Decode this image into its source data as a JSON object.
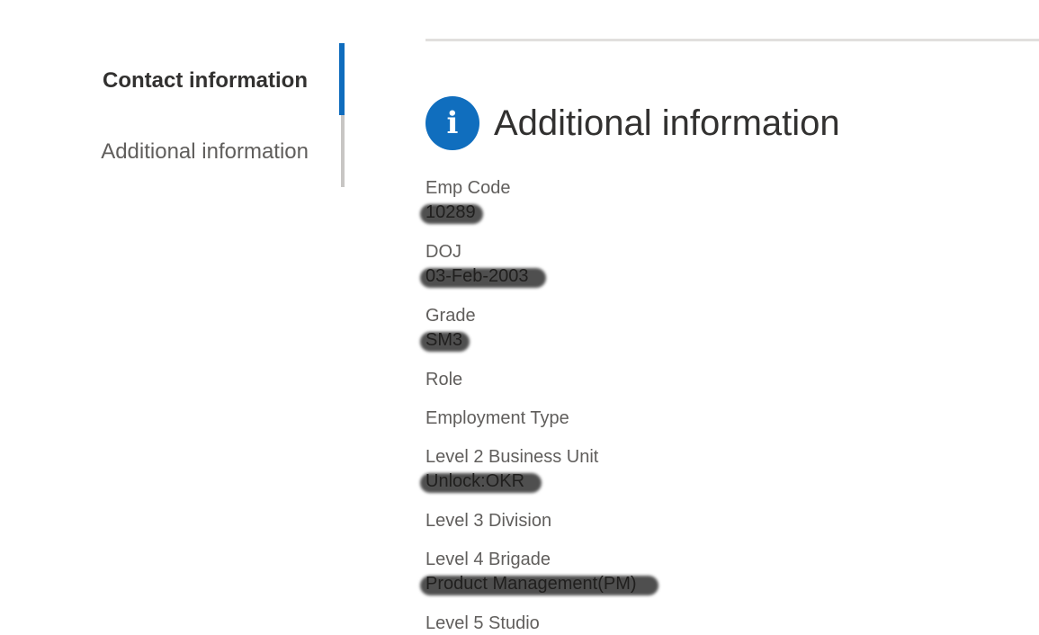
{
  "nav": {
    "items": [
      {
        "label": "Contact information",
        "active": true
      },
      {
        "label": "Additional information",
        "active": false
      }
    ]
  },
  "section": {
    "icon": "info-icon",
    "title": "Additional information"
  },
  "fields": [
    {
      "label": "Emp Code",
      "value": "10289"
    },
    {
      "label": "DOJ",
      "value": "03-Feb-2003"
    },
    {
      "label": "Grade",
      "value": "SM3"
    },
    {
      "label": "Role",
      "value": ""
    },
    {
      "label": "Employment Type",
      "value": ""
    },
    {
      "label": "Level 2 Business Unit",
      "value": "Unlock:OKR"
    },
    {
      "label": "Level 3 Division",
      "value": ""
    },
    {
      "label": "Level 4 Brigade",
      "value": "Product Management(PM)"
    },
    {
      "label": "Level 5 Studio",
      "value": ""
    }
  ],
  "colors": {
    "accent": "#0f6cbd",
    "icon_bg": "#106ebe"
  }
}
